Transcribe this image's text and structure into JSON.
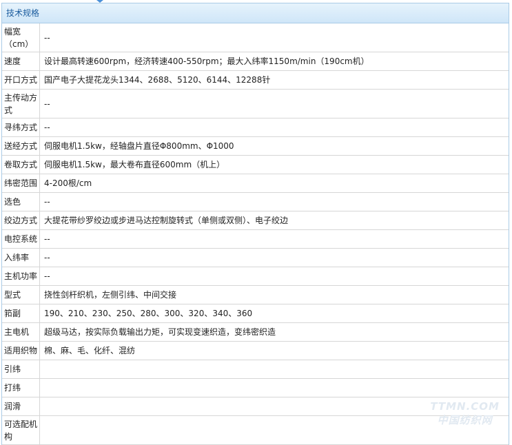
{
  "header": {
    "title": "技术规格"
  },
  "rows": [
    {
      "label": "幅宽（cm）",
      "value": "--"
    },
    {
      "label": "速度",
      "value": "设计最高转速600rpm，经济转速400-550rpm；最大入纬率1150m/min（190cm机）"
    },
    {
      "label": "开口方式",
      "value": "国产电子大提花龙头1344、2688、5120、6144、12288针"
    },
    {
      "label": "主传动方式",
      "value": "--"
    },
    {
      "label": "寻纬方式",
      "value": "--"
    },
    {
      "label": "送经方式",
      "value": "伺服电机1.5kw，经轴盘片直径Φ800mm、Φ1000"
    },
    {
      "label": "卷取方式",
      "value": "伺服电机1.5kw，最大卷布直径600mm（机上）"
    },
    {
      "label": "纬密范围",
      "value": "4-200根/cm"
    },
    {
      "label": "选色",
      "value": "--"
    },
    {
      "label": "绞边方式",
      "value": "大提花带纱罗绞边或步进马达控制旋转式（单侧或双侧）、电子绞边"
    },
    {
      "label": "电控系统",
      "value": "--"
    },
    {
      "label": "入纬率",
      "value": "--"
    },
    {
      "label": "主机功率",
      "value": "--"
    },
    {
      "label": "型式",
      "value": "挠性剑杆织机，左侧引纬、中间交接"
    },
    {
      "label": "筘副",
      "value": "190、210、230、250、280、300、320、340、360"
    },
    {
      "label": "主电机",
      "value": "超级马达，按实际负载输出力矩，可实现变速织造，变纬密织造"
    },
    {
      "label": "适用织物",
      "value": "棉、麻、毛、化纤、混纺"
    },
    {
      "label": "引纬",
      "value": ""
    },
    {
      "label": "打纬",
      "value": ""
    },
    {
      "label": "润滑",
      "value": ""
    },
    {
      "label": "可选配机构",
      "value": ""
    }
  ],
  "watermark": {
    "line1": "TTMN.COM",
    "line2": "中国纺织网"
  }
}
